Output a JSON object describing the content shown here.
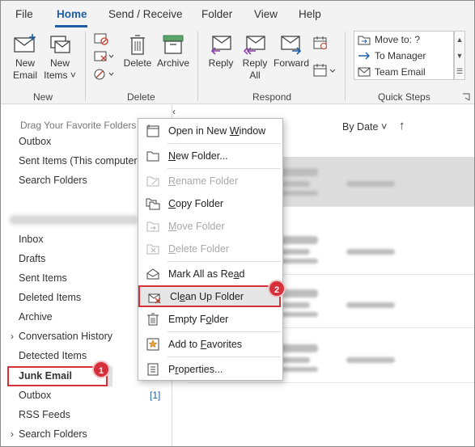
{
  "menu": {
    "tabs": [
      "File",
      "Home",
      "Send / Receive",
      "Folder",
      "View",
      "Help"
    ]
  },
  "ribbon": {
    "new_email": [
      "New",
      "Email"
    ],
    "new_items": [
      "New",
      "Items ˅"
    ],
    "delete": "Delete",
    "archive": "Archive",
    "reply": "Reply",
    "reply_all": [
      "Reply",
      "All"
    ],
    "forward": "Forward",
    "groups": {
      "new": "New",
      "delete": "Delete",
      "respond": "Respond",
      "quick_steps": "Quick Steps"
    },
    "quick_steps": [
      "Move to: ?",
      "To Manager",
      "Team Email"
    ]
  },
  "folder_pane": {
    "drag_hint": "Drag Your Favorite Folders H",
    "top_items": [
      "Outbox",
      "Sent Items (This computer o",
      "Search Folders"
    ],
    "items": [
      "Inbox",
      "Drafts",
      "Sent Items",
      "Deleted Items",
      "Archive",
      "Conversation History",
      "Detected Items",
      "Junk Email",
      "Outbox",
      "RSS Feeds",
      "Search Folders"
    ],
    "outbox_count": "[1]"
  },
  "message_list": {
    "sort_label": "By Date",
    "sort_arrow": "↑"
  },
  "context_menu": {
    "items": [
      {
        "pre": "Open in New ",
        "u": "W",
        "post": "indow"
      },
      {
        "pre": "",
        "u": "N",
        "post": "ew Folder..."
      },
      {
        "pre": "",
        "u": "R",
        "post": "ename Folder"
      },
      {
        "pre": "",
        "u": "C",
        "post": "opy Folder"
      },
      {
        "pre": "",
        "u": "M",
        "post": "ove Folder"
      },
      {
        "pre": "",
        "u": "D",
        "post": "elete Folder"
      },
      {
        "pre": "Mark All as Re",
        "u": "a",
        "post": "d"
      },
      {
        "pre": "Cl",
        "u": "e",
        "post": "an Up Folder"
      },
      {
        "pre": "Empty F",
        "u": "o",
        "post": "lder"
      },
      {
        "pre": "Add to ",
        "u": "F",
        "post": "avorites"
      },
      {
        "pre": "P",
        "u": "r",
        "post": "operties..."
      }
    ]
  },
  "badges": {
    "step1": "1",
    "step2": "2"
  },
  "colors": {
    "accent": "#1e5ea8",
    "highlight": "#d6303b"
  }
}
